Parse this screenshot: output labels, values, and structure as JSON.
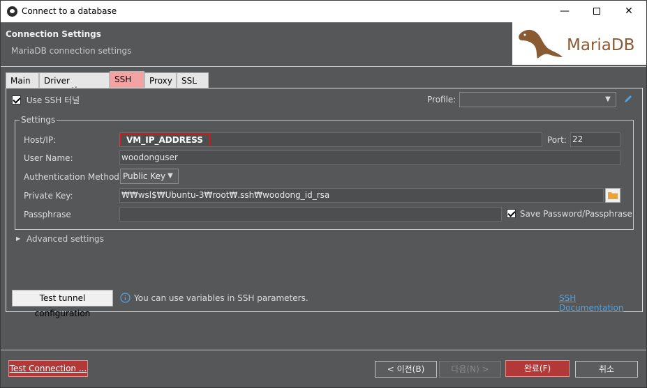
{
  "window": {
    "title": "Connect to a database"
  },
  "header": {
    "title": "Connection Settings",
    "subtitle": "MariaDB connection settings",
    "logo_text": "MariaDB"
  },
  "tabs": [
    {
      "label": "Main"
    },
    {
      "label": "Driver properties"
    },
    {
      "label": "SSH"
    },
    {
      "label": "Proxy"
    },
    {
      "label": "SSL"
    }
  ],
  "ssh": {
    "use_tunnel_label": "Use SSH 터널",
    "use_tunnel_checked": true,
    "profile_label": "Profile:",
    "profile_value": "",
    "settings_legend": "Settings",
    "host_label": "Host/IP:",
    "host_value": "VM_IP_ADDRESS",
    "port_label": "Port:",
    "port_value": "22",
    "user_label": "User Name:",
    "user_value": "woodonguser",
    "auth_label": "Authentication Method:",
    "auth_value": "Public Key",
    "key_label": "Private Key:",
    "key_value": "₩₩wsl$₩Ubuntu-3₩root₩.ssh₩woodong_id_rsa",
    "pass_label": "Passphrase",
    "pass_value": "",
    "save_pass_label": "Save Password/Passphrase",
    "save_pass_checked": true,
    "advanced_label": "Advanced settings",
    "test_tunnel_label": "Test tunnel configuration",
    "info_text": "You can use variables in SSH parameters.",
    "docs_link": "SSH Documentation"
  },
  "footer": {
    "test_connection": "Test Connection ...",
    "prev": "< 이전(B)",
    "next": "다음(N) >",
    "finish": "완료(F)",
    "cancel": "취소"
  }
}
